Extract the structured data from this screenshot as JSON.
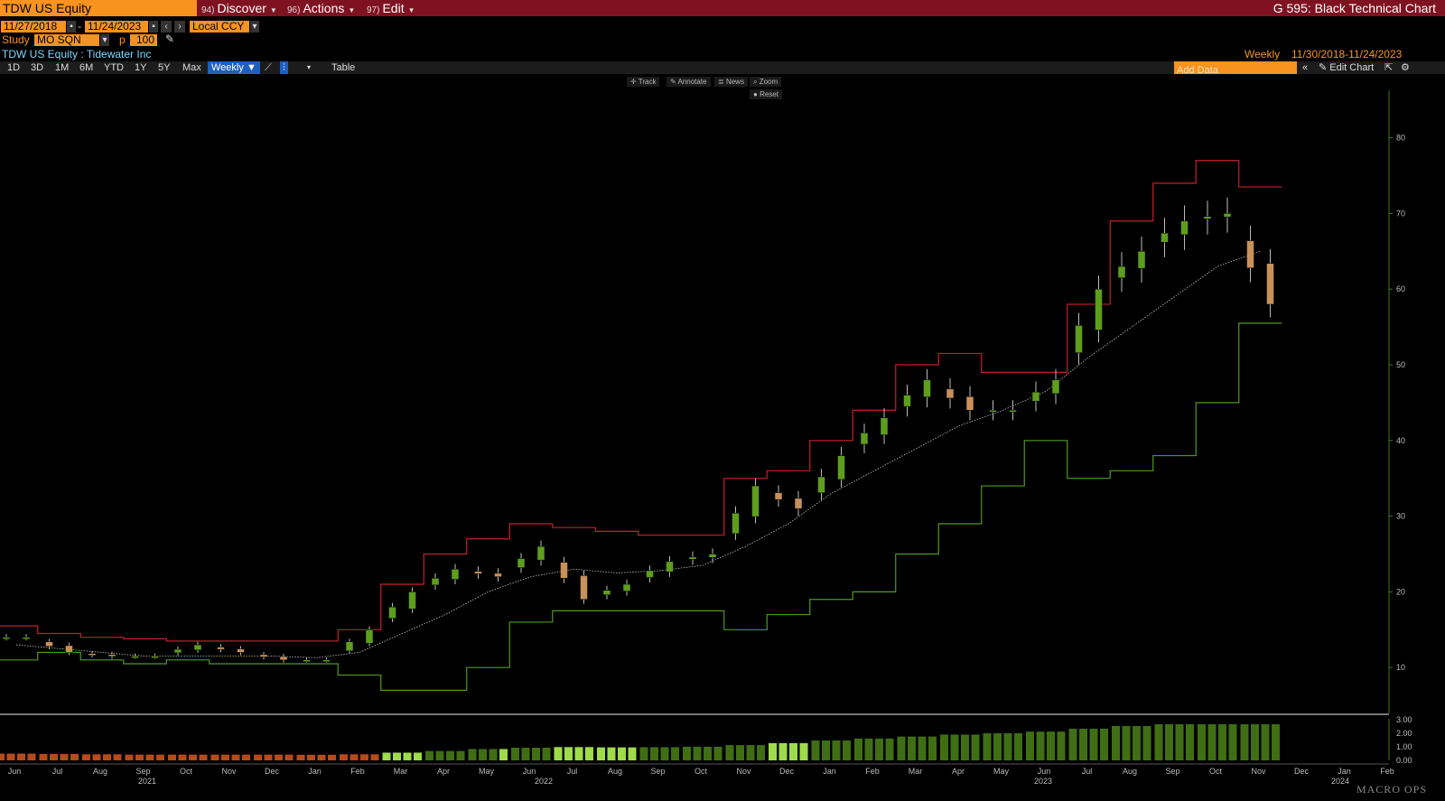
{
  "header": {
    "ticker": "TDW US Equity",
    "menus": [
      {
        "num": "94)",
        "label": "Discover"
      },
      {
        "num": "96)",
        "label": "Actions"
      },
      {
        "num": "97)",
        "label": "Edit"
      }
    ],
    "function_name": "G 595: Black Technical Chart"
  },
  "controls": {
    "start_date": "11/27/2018",
    "end_date": "11/24/2023",
    "currency": "Local CCY",
    "study_label": "Study",
    "study_value": "MO SQN",
    "p_label": "p",
    "p_value": "100",
    "security_desc": "TDW US Equity : Tidewater Inc",
    "period": "Weekly",
    "date_range": "11/30/2018-11/24/2023",
    "add_data_placeholder": "Add Data",
    "edit_chart": "Edit Chart"
  },
  "toolbar": {
    "ranges": [
      "1D",
      "3D",
      "1M",
      "6M",
      "YTD",
      "1Y",
      "5Y",
      "Max"
    ],
    "period_button": "Weekly",
    "table_label": "Table"
  },
  "chart_tools": {
    "track": "Track",
    "annotate": "Annotate",
    "news": "News",
    "zoom": "Zoom",
    "reset": "Reset"
  },
  "watermark": "MACRO OPS",
  "colors": {
    "up_candle": "#5d9e1e",
    "down_candle": "#c8915a",
    "upper_band": "#c81e2e",
    "lower_band": "#4e9a1e",
    "moving_average": "#c0c0c0",
    "accent_orange": "#f7931e",
    "title_bar": "#7e1220"
  },
  "chart_data": {
    "type": "line",
    "x": [
      "2021-06",
      "2021-07",
      "2021-08",
      "2021-09",
      "2021-10",
      "2021-11",
      "2021-12",
      "2022-01",
      "2022-02",
      "2022-03",
      "2022-04",
      "2022-05",
      "2022-06",
      "2022-07",
      "2022-08",
      "2022-09",
      "2022-10",
      "2022-11",
      "2022-12",
      "2023-01",
      "2023-02",
      "2023-03",
      "2023-04",
      "2023-05",
      "2023-06",
      "2023-07",
      "2023-08",
      "2023-09",
      "2023-10",
      "2023-11"
    ],
    "series": [
      {
        "key": "close",
        "values": [
          14,
          12,
          11.5,
          11.5,
          13,
          12,
          11,
          11,
          15,
          20,
          23,
          22,
          26,
          19,
          21,
          24,
          25,
          34,
          31,
          38,
          43,
          48,
          44,
          44,
          48,
          60,
          65,
          69,
          70,
          58
        ]
      },
      {
        "key": "upper_band",
        "values": [
          15.5,
          14.5,
          14,
          13.8,
          13.5,
          13.5,
          13.5,
          13.5,
          15,
          21,
          25,
          27,
          29,
          28.5,
          28,
          27.5,
          27.5,
          35,
          36,
          40,
          44,
          50,
          51.5,
          49,
          49,
          58,
          69,
          74,
          77,
          73.5
        ]
      },
      {
        "key": "moving_average",
        "values": [
          13,
          12.5,
          12,
          11.5,
          11.5,
          11.5,
          11.5,
          11.3,
          12,
          14.5,
          17,
          20,
          22,
          23,
          22.5,
          22.8,
          23.5,
          26,
          29,
          33,
          36,
          39,
          42,
          44,
          46.5,
          51,
          55,
          59,
          63,
          65
        ]
      },
      {
        "key": "lower_band",
        "values": [
          11,
          12,
          11,
          10.5,
          11,
          10.5,
          10.5,
          10.5,
          9,
          7,
          7,
          10,
          16,
          17.5,
          17.5,
          17.5,
          17.5,
          15,
          17,
          19,
          20,
          25,
          29,
          34,
          40,
          35,
          36,
          38,
          45,
          55.5
        ]
      }
    ],
    "ylim": [
      0,
      85
    ],
    "y_ticks": [
      10,
      20,
      30,
      40,
      50,
      60,
      70,
      80
    ],
    "x_tick_labels": [
      "Jun",
      "Jul",
      "Aug",
      "Sep",
      "Oct",
      "Nov",
      "Dec",
      "Jan",
      "Feb",
      "Mar",
      "Apr",
      "May",
      "Jun",
      "Jul",
      "Aug",
      "Sep",
      "Oct",
      "Nov",
      "Dec",
      "Jan",
      "Feb",
      "Mar",
      "Apr",
      "May",
      "Jun",
      "Jul",
      "Aug",
      "Sep",
      "Oct",
      "Nov",
      "Dec",
      "Jan",
      "Feb"
    ],
    "year_labels": [
      "2021",
      "2022",
      "2023",
      "2024"
    ],
    "volume_panel": {
      "y_ticks": [
        "3.00",
        "2.00",
        "1.00",
        "0.00"
      ]
    }
  }
}
